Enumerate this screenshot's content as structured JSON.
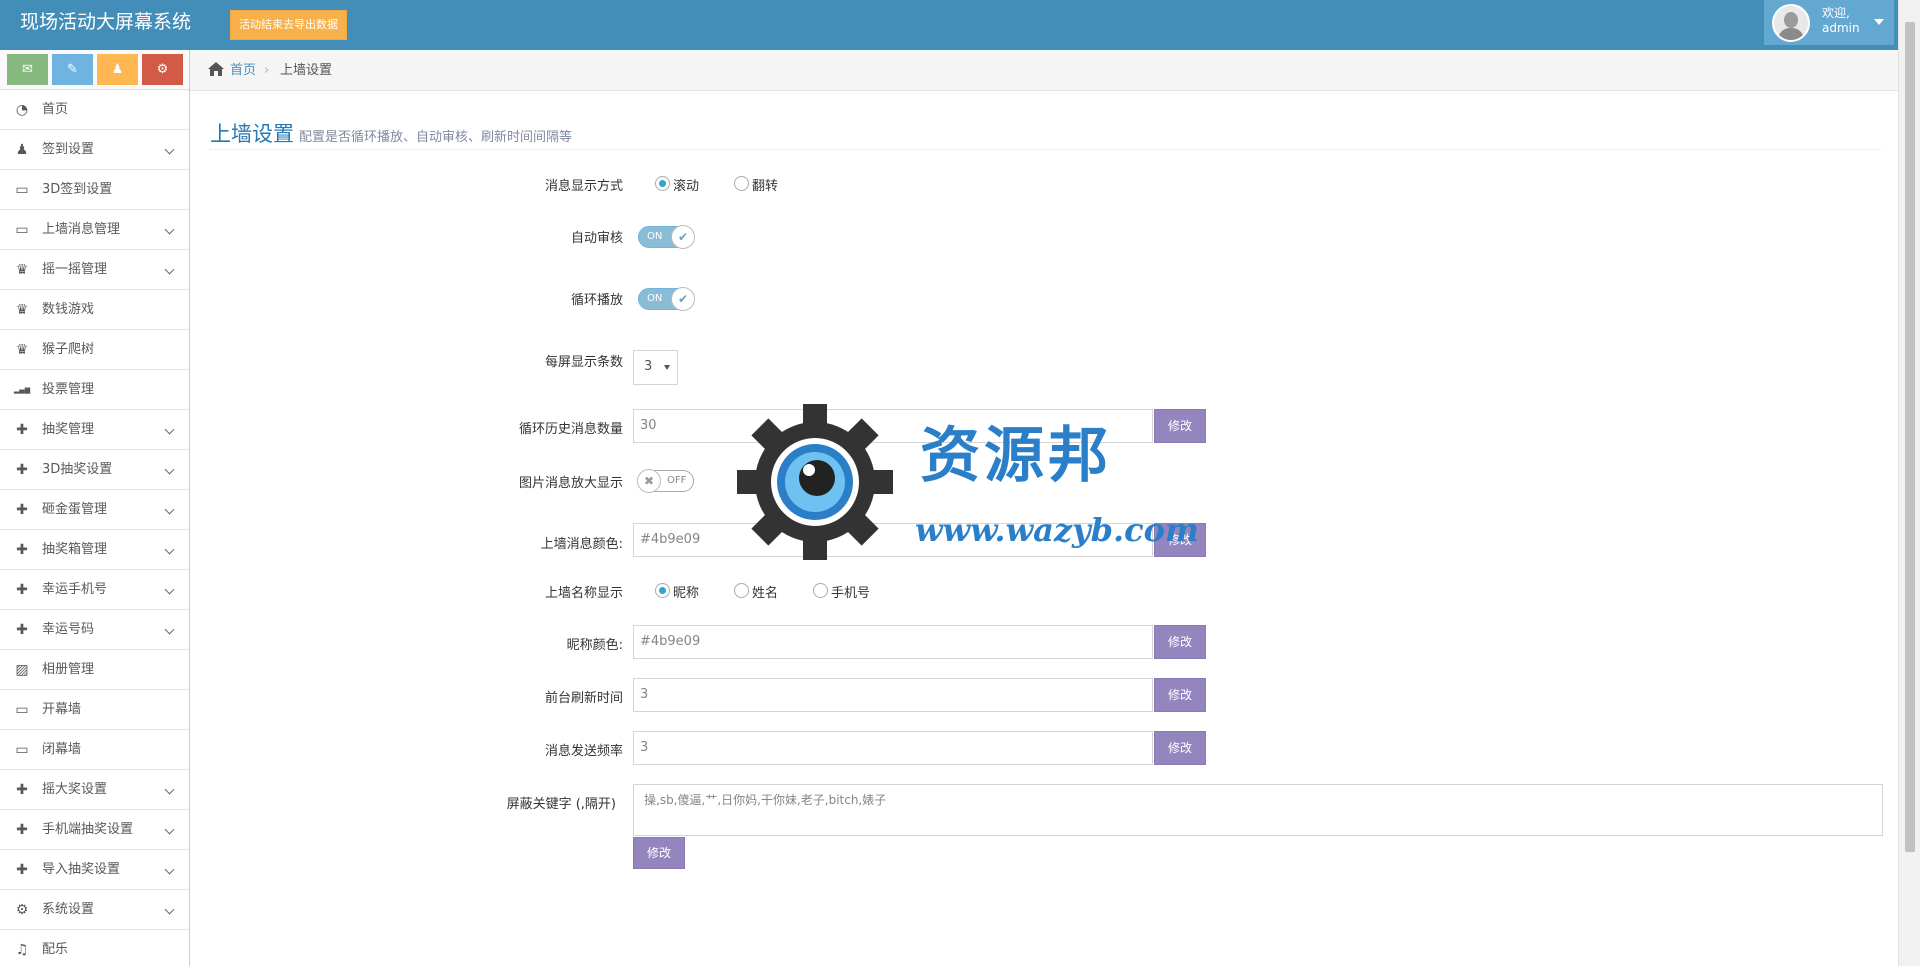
{
  "navbar": {
    "brand": "现场活动大屏幕系统",
    "export_label": "活动结束去导出数据",
    "user_greeting": "欢迎,",
    "user_name": "admin"
  },
  "shortcuts": [
    {
      "icon": "comment-icon",
      "glyph": "✉",
      "color": "#87b87f"
    },
    {
      "icon": "pencil-icon",
      "glyph": "✎",
      "color": "#6fb3e0"
    },
    {
      "icon": "users-icon",
      "glyph": "♟",
      "color": "#ffb752"
    },
    {
      "icon": "cogs-icon",
      "glyph": "⚙",
      "color": "#d15b47"
    }
  ],
  "sidebar": {
    "items": [
      {
        "label": "首页",
        "icon": "dashboard-icon",
        "glyph": "◔",
        "arrow": false
      },
      {
        "label": "签到设置",
        "icon": "group-icon",
        "glyph": "♟",
        "arrow": true
      },
      {
        "label": "3D签到设置",
        "icon": "desktop-icon",
        "glyph": "▭",
        "arrow": false
      },
      {
        "label": "上墙消息管理",
        "icon": "desktop-icon",
        "glyph": "▭",
        "arrow": true
      },
      {
        "label": "摇一摇管理",
        "icon": "trophy-icon",
        "glyph": "♛",
        "arrow": true
      },
      {
        "label": "数钱游戏",
        "icon": "trophy-icon",
        "glyph": "♛",
        "arrow": false
      },
      {
        "label": "猴子爬树",
        "icon": "trophy-icon",
        "glyph": "♛",
        "arrow": false
      },
      {
        "label": "投票管理",
        "icon": "signal-icon",
        "glyph": "▂▄▆",
        "arrow": false
      },
      {
        "label": "抽奖管理",
        "icon": "gift-icon",
        "glyph": "✚",
        "arrow": true
      },
      {
        "label": "3D抽奖设置",
        "icon": "gift-icon",
        "glyph": "✚",
        "arrow": true
      },
      {
        "label": "砸金蛋管理",
        "icon": "gift-icon",
        "glyph": "✚",
        "arrow": true
      },
      {
        "label": "抽奖箱管理",
        "icon": "gift-icon",
        "glyph": "✚",
        "arrow": true
      },
      {
        "label": "幸运手机号",
        "icon": "gift-icon",
        "glyph": "✚",
        "arrow": true
      },
      {
        "label": "幸运号码",
        "icon": "gift-icon",
        "glyph": "✚",
        "arrow": true
      },
      {
        "label": "相册管理",
        "icon": "picture-icon",
        "glyph": "▨",
        "arrow": false
      },
      {
        "label": "开幕墙",
        "icon": "desktop-icon",
        "glyph": "▭",
        "arrow": false
      },
      {
        "label": "闭幕墙",
        "icon": "desktop-icon",
        "glyph": "▭",
        "arrow": false
      },
      {
        "label": "摇大奖设置",
        "icon": "gift-icon",
        "glyph": "✚",
        "arrow": true
      },
      {
        "label": "手机端抽奖设置",
        "icon": "gift-icon",
        "glyph": "✚",
        "arrow": true
      },
      {
        "label": "导入抽奖设置",
        "icon": "gift-icon",
        "glyph": "✚",
        "arrow": true
      },
      {
        "label": "系统设置",
        "icon": "cog-icon",
        "glyph": "⚙",
        "arrow": true
      },
      {
        "label": "配乐",
        "icon": "music-icon",
        "glyph": "♫",
        "arrow": false
      }
    ]
  },
  "breadcrumb": {
    "home": "首页",
    "separator": "›",
    "current": "上墙设置"
  },
  "page": {
    "title": "上墙设置",
    "subtitle": "配置是否循环播放、自动审核、刷新时间间隔等"
  },
  "form": {
    "display_mode": {
      "label": "消息显示方式",
      "options": [
        "滚动",
        "翻转"
      ],
      "selected": "滚动"
    },
    "auto_review": {
      "label": "自动审核",
      "state": "ON",
      "check": "✔"
    },
    "loop_play": {
      "label": "循环播放",
      "state": "ON",
      "check": "✔"
    },
    "per_screen": {
      "label": "每屏显示条数",
      "value": "3"
    },
    "history_count": {
      "label": "循环历史消息数量",
      "value": "30",
      "button": "修改"
    },
    "image_zoom": {
      "label": "图片消息放大显示",
      "state": "OFF",
      "cross": "✖"
    },
    "message_color": {
      "label": "上墙消息颜色:",
      "value": "#4b9e09",
      "button": "修改"
    },
    "name_display": {
      "label": "上墙名称显示",
      "options": [
        "昵称",
        "姓名",
        "手机号"
      ],
      "selected": "昵称"
    },
    "nickname_color": {
      "label": "昵称颜色:",
      "value": "#4b9e09",
      "button": "修改"
    },
    "refresh_time": {
      "label": "前台刷新时间",
      "value": "3",
      "button": "修改"
    },
    "send_rate": {
      "label": "消息发送频率",
      "value": "3",
      "button": "修改"
    },
    "blocked_words": {
      "label": "屏蔽关键字 (,隔开)",
      "value": "操,sb,傻逼,艹,日你妈,干你妹,老子,bitch,婊子",
      "button": "修改"
    }
  },
  "watermark": {
    "cn": "资源邦",
    "en": "www.wazyb.com"
  },
  "colors": {
    "navbar": "#438eb9",
    "accent": "#2679b5",
    "button_purple": "#9585bf",
    "export_orange": "#f8b04a"
  }
}
